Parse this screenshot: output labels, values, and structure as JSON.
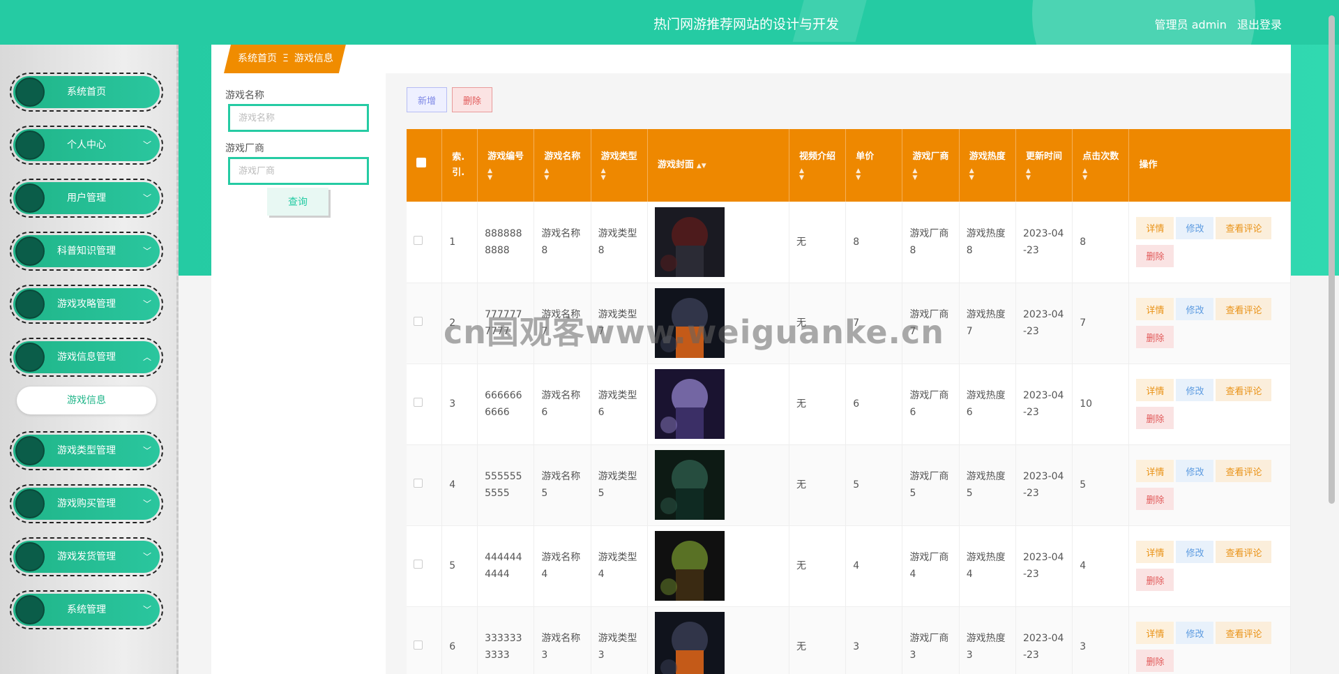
{
  "header": {
    "title": "热门网游推荐网站的设计与开发",
    "user_label": "管理员 admin",
    "logout": "退出登录"
  },
  "sidebar": {
    "items": [
      {
        "label": "系统首页",
        "expanded": null
      },
      {
        "label": "个人中心",
        "expanded": false
      },
      {
        "label": "用户管理",
        "expanded": false
      },
      {
        "label": "科普知识管理",
        "expanded": false
      },
      {
        "label": "游戏攻略管理",
        "expanded": false
      },
      {
        "label": "游戏信息管理",
        "expanded": true
      },
      {
        "label": "游戏类型管理",
        "expanded": false
      },
      {
        "label": "游戏购买管理",
        "expanded": false
      },
      {
        "label": "游戏发货管理",
        "expanded": false
      },
      {
        "label": "系统管理",
        "expanded": false
      }
    ],
    "submenu_active": "游戏信息"
  },
  "breadcrumb": {
    "home": "系统首页",
    "separator": "Ξ",
    "current": "游戏信息"
  },
  "search": {
    "name_label": "游戏名称",
    "name_placeholder": "游戏名称",
    "vendor_label": "游戏厂商",
    "vendor_placeholder": "游戏厂商",
    "query_button": "查询"
  },
  "toolbar": {
    "add": "新增",
    "delete": "删除"
  },
  "table": {
    "columns": [
      "索引",
      "游戏编号",
      "游戏名称",
      "游戏类型",
      "游戏封面",
      "视频介绍",
      "单价",
      "游戏厂商",
      "游戏热度",
      "更新时间",
      "点击次数",
      "操作"
    ],
    "header_lines": {
      "index": "索.引.",
      "code": "游戏编号",
      "name": "游戏名称",
      "type": "游戏类型",
      "cover": "游戏封面",
      "video": "视频介绍",
      "price": "单价",
      "vendor": "游戏厂商",
      "heat": "游戏热度",
      "updated": "更新时间",
      "clicks": "点击次数",
      "ops": "操作"
    },
    "rows": [
      {
        "index": "1",
        "code": "8888888888",
        "name": "游戏名称8",
        "type": "游戏类型8",
        "video": "无",
        "price": "8",
        "vendor": "游戏厂商8",
        "heat": "游戏热度8",
        "updated": "2023-04-23",
        "clicks": "8"
      },
      {
        "index": "2",
        "code": "7777777777",
        "name": "游戏名称7",
        "type": "游戏类型7",
        "video": "无",
        "price": "7",
        "vendor": "游戏厂商7",
        "heat": "游戏热度7",
        "updated": "2023-04-23",
        "clicks": "7"
      },
      {
        "index": "3",
        "code": "6666666666",
        "name": "游戏名称6",
        "type": "游戏类型6",
        "video": "无",
        "price": "6",
        "vendor": "游戏厂商6",
        "heat": "游戏热度6",
        "updated": "2023-04-23",
        "clicks": "10"
      },
      {
        "index": "4",
        "code": "5555555555",
        "name": "游戏名称5",
        "type": "游戏类型5",
        "video": "无",
        "price": "5",
        "vendor": "游戏厂商5",
        "heat": "游戏热度5",
        "updated": "2023-04-23",
        "clicks": "5"
      },
      {
        "index": "5",
        "code": "4444444444",
        "name": "游戏名称4",
        "type": "游戏类型4",
        "video": "无",
        "price": "4",
        "vendor": "游戏厂商4",
        "heat": "游戏热度4",
        "updated": "2023-04-23",
        "clicks": "4"
      },
      {
        "index": "6",
        "code": "3333333333",
        "name": "游戏名称3",
        "type": "游戏类型3",
        "video": "无",
        "price": "3",
        "vendor": "游戏厂商3",
        "heat": "游戏热度3",
        "updated": "2023-04-23",
        "clicks": "3"
      }
    ],
    "actions": {
      "detail": "详情",
      "edit": "修改",
      "comments": "查看评论",
      "delete": "删除"
    }
  },
  "watermark": "cn国观客www.weiguanke.cn",
  "colors": {
    "primary": "#25cba3",
    "table_header": "#ee8800",
    "sidebar_dot": "#0b5d49"
  }
}
